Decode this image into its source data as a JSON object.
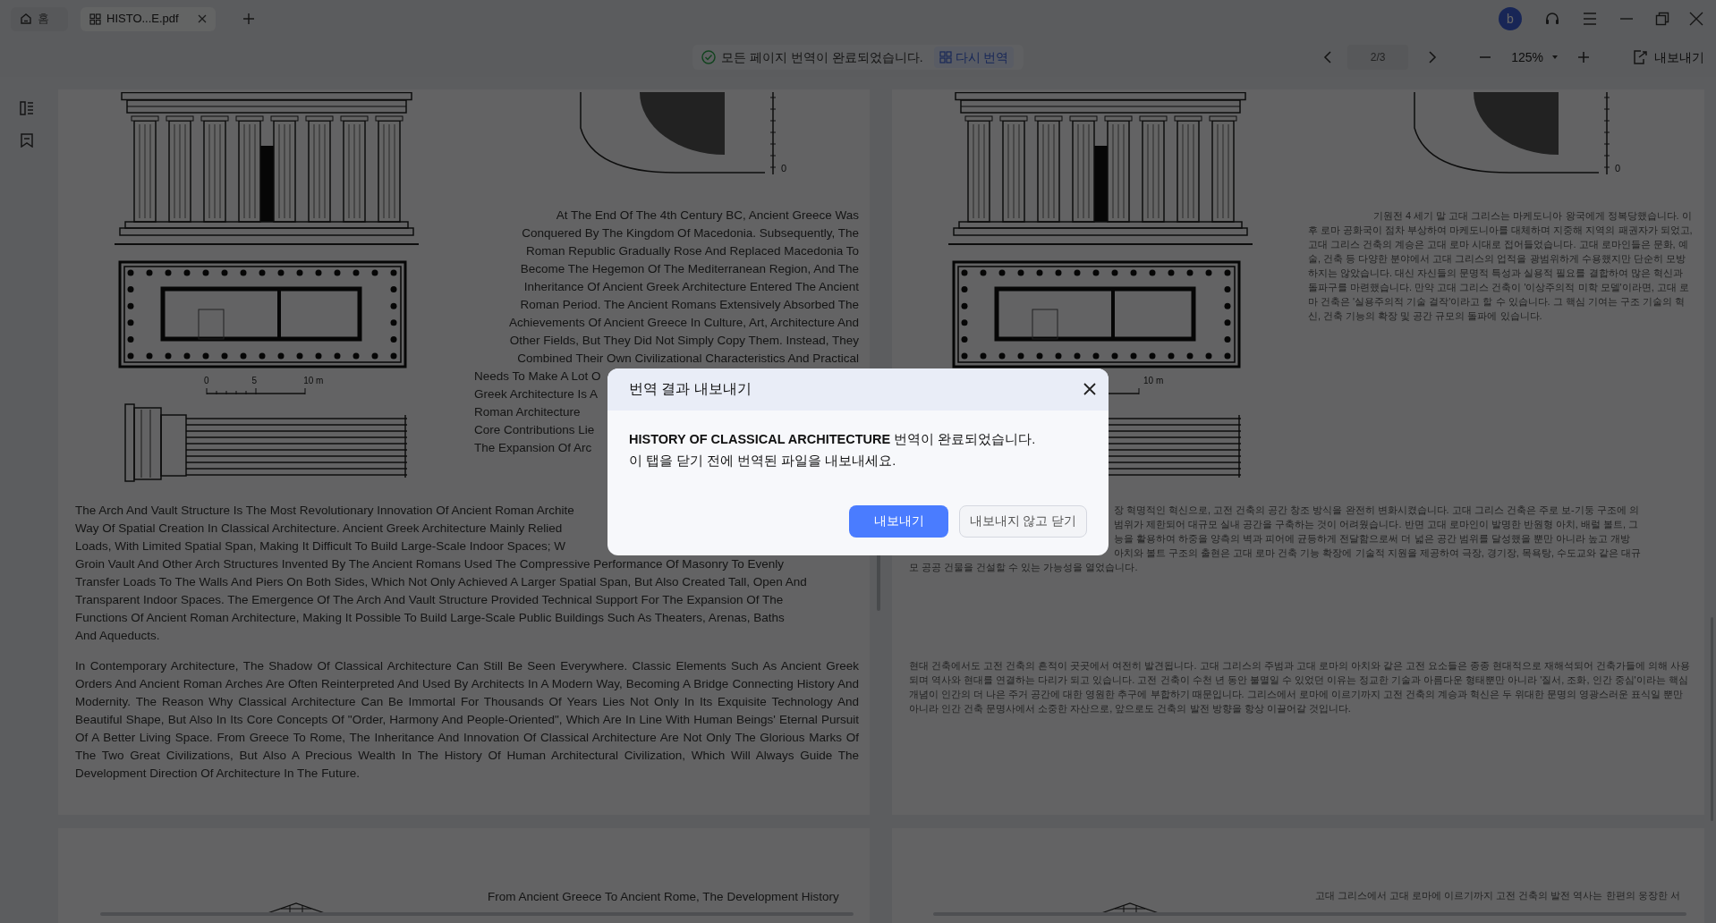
{
  "tabs": [
    {
      "kind": "home",
      "label": "홈",
      "selected": false
    },
    {
      "kind": "document",
      "label": "HISTO...E.pdf",
      "selected": true
    }
  ],
  "account": {
    "initial": "b"
  },
  "toolbar": {
    "status": "모든 페이지 번역이 완료되었습니다.",
    "retranslate_button": "다시 번역",
    "page_field": "2/3",
    "zoom": "125%",
    "export_button": "내보내기"
  },
  "original_page": {
    "scale_labels": [
      "0",
      "5",
      "10 m"
    ],
    "axis_label": "0",
    "side_text": {
      "lines": [
        "At The End Of The 4th Century BC, Ancient Greece Was",
        "Conquered By The Kingdom Of Macedonia. Subsequently, The",
        "Roman Republic Gradually Rose And Replaced Macedonia To",
        "Become The Hegemon Of The Mediterranean Region, And The",
        "Inheritance Of Ancient Greek Architecture Entered The Ancient",
        "Roman Period. The Ancient Romans Extensively Absorbed The",
        "Achievements Of Ancient Greece In Culture, Art, Architecture And",
        "Other Fields, But They Did Not Simply Copy Them. Instead, They",
        "Combined Their Own Civilizational Characteristics And Practical"
      ],
      "cut_lines": [
        "Needs To Make A Lot O",
        "Greek Architecture Is A",
        "Roman Architecture",
        "Core Contributions Lie",
        "The Expansion Of Arc"
      ]
    },
    "paragraph_1": {
      "cut_lines": [
        "The Arch And Vault Structure Is The Most Revolutionary Innovation Of Ancient Roman Archite",
        "Way Of Spatial Creation In Classical Architecture. Ancient Greek Architecture Mainly Relied",
        "Loads, With Limited Spatial Span, Making It Difficult To Build Large-Scale Indoor Spaces; W"
      ],
      "lines": [
        "Groin Vault And Other Arch Structures Invented By The Ancient Romans Used The Compressive Performance Of Masonry To Evenly",
        "Transfer Loads To The Walls And Piers On Both Sides, Which Not Only Achieved A Larger Spatial Span, But Also Created Tall, Open And",
        "Transparent Indoor Spaces. The Emergence Of The Arch And Vault Structure Provided Technical Support For The Expansion Of The",
        "Functions Of Ancient Roman Architecture, Making It Possible To Build Large-Scale Public Buildings Such As Theaters, Arenas, Baths",
        "And Aqueducts."
      ]
    },
    "paragraph_2": "In Contemporary Architecture, The Shadow Of Classical Architecture Can Still Be Seen Everywhere. Classic Elements Such As Ancient Greek Orders And Ancient Roman Arches Are Often Reinterpreted And Used By Architects In A Modern Way, Becoming A Bridge Connecting History And Modernity. The Reason Why Classical Architecture Can Be Immortal For Thousands Of Years Lies Not Only In Its Exquisite Technology And Beautiful Shape, But Also In Its Core Concepts Of \"Order, Harmony And People-Oriented\", Which Are In Line With Human Beings' Eternal Pursuit Of A Better Living Space. From Greece To Rome, The Inheritance And Innovation Of Classical Architecture Are Not Only The Glorious Marks Of The Two Great Civilizations, But Also A Precious Wealth In The History Of Human Architectural Civilization, Which Will Always Guide The Development Direction Of Architecture In The Future."
  },
  "translated_page": {
    "scale_label": "10 m",
    "axis_label": "0",
    "side_text": "기원전 4 세기 말 고대 그리스는 마케도니아 왕국에게 정복당했습니다. 이후 로마 공화국이 점차 부상하여 마케도니아를 대체하며 지중해 지역의 패권자가 되었고, 고대 그리스 건축의 계승은 고대 로마 시대로 접어들었습니다. 고대 로마인들은 문화, 예술, 건축 등 다양한 분야에서 고대 그리스의 업적을 광범위하게 수용했지만 단순히 모방하지는 않았습니다. 대신 자신들의 문명적 특성과 실용적 필요를 결합하여 많은 혁신과 돌파구를 마련했습니다. 만약 고대 그리스 건축이 '이상주의적 미학 모델'이라면, 고대 로마 건축은 '실용주의적 기술 걸작'이라고 할 수 있습니다. 그 핵심 기여는 구조 기술의 혁신, 건축 기능의 확장 및 공간 규모의 돌파에 있습니다.",
    "paragraph_1": {
      "cut_lines": [
        "장 혁명적인 혁신으로, 고전 건축의 공간 창조 방식을 완전히 변화시켰습니다. 고대 그리스 건축은 주로 보-기둥 구조에 의",
        "범위가 제한되어 대규모 실내 공간을 구축하는 것이 어려웠습니다. 반면 고대 로마인이 발명한 반원형 아치, 배럴 볼트, 그",
        "능을 활용하여 하중을 양측의 벽과 피어에 균등하게 전달함으로써 더 넓은 공간 범위를 달성했을 뿐만 아니라 높고 개방",
        "아치와 볼트 구조의 출현은 고대 로마 건축 기능 확장에 기술적 지원을 제공하여 극장, 경기장, 목욕탕, 수도교와 같은 대규"
      ],
      "lines": [
        "모 공공 건물을 건설할 수 있는 가능성을 열었습니다."
      ]
    },
    "paragraph_2": "현대 건축에서도 고전 건축의 흔적이 곳곳에서 여전히 발견됩니다. 고대 그리스의 주범과 고대 로마의 아치와 같은 고전 요소들은 종종 현대적으로 재해석되어 건축가들에 의해 사용되며 역사와 현대를 연결하는 다리가 되고 있습니다. 고전 건축이 수천 년 동안 불멸일 수 있었던 이유는 정교한 기술과 아름다운 형태뿐만 아니라 '질서, 조화, 인간 중심'이라는 핵심 개념이 인간의 더 나은 주거 공간에 대한 영원한 추구에 부합하기 때문입니다. 그리스에서 로마에 이르기까지 고전 건축의 계승과 혁신은 두 위대한 문명의 영광스러운 표식일 뿐만 아니라 인간 건축 문명사에서 소중한 자산으로, 앞으로도 건축의 발전 방향을 항상 이끌어갈 것입니다."
  },
  "next_pages": {
    "original": "From Ancient Greece To Ancient Rome, The Development History",
    "translated": "고대 그리스에서 고대 로마에 이르기까지 고전 건축의 발전 역사는 한편의 웅장한 서"
  },
  "dialog": {
    "title": "번역 결과 내보내기",
    "message": [
      "**HISTORY OF CLASSICAL ARCHITECTURE** 번역이 완료되었습니다.",
      "이 탭을 닫기 전에 번역된 파일을 내보내세요."
    ],
    "buttons": [
      {
        "kind": "primary",
        "label": "내보내기"
      },
      {
        "kind": "secondary",
        "label": "내보내지 않고 닫기"
      }
    ]
  }
}
